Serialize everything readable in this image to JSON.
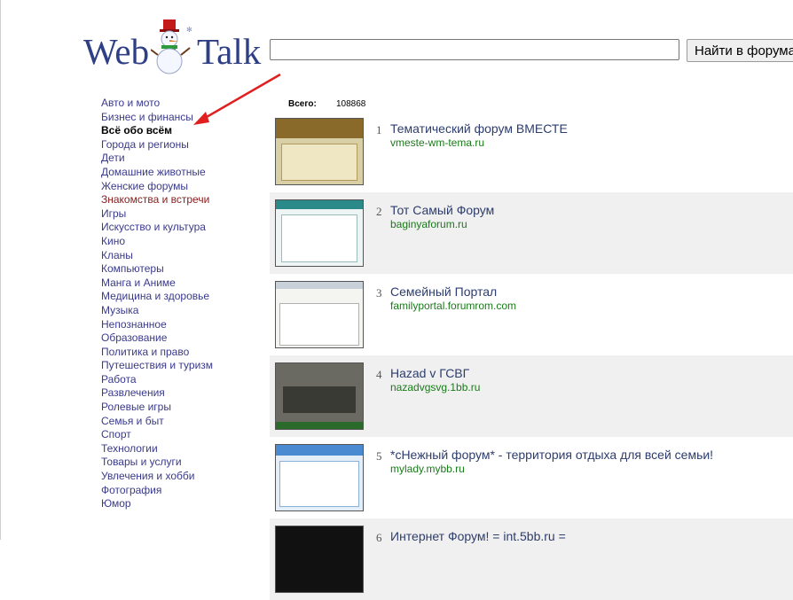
{
  "logo": {
    "word1": "Web",
    "word2": "Talk"
  },
  "search": {
    "value": "",
    "placeholder": "",
    "button_label": "Найти в форумах"
  },
  "categories": [
    "Авто и мото",
    "Бизнес и финансы",
    "Всё обо всём",
    "Города и регионы",
    "Дети",
    "Домашние животные",
    "Женские форумы",
    "Знакомства и встречи",
    "Игры",
    "Искусство и культура",
    "Кино",
    "Кланы",
    "Компьютеры",
    "Манга и Аниме",
    "Медицина и здоровье",
    "Музыка",
    "Непознанное",
    "Образование",
    "Политика и право",
    "Путешествия и туризм",
    "Работа",
    "Развлечения",
    "Ролевые игры",
    "Семья и быт",
    "Спорт",
    "Технологии",
    "Товары и услуги",
    "Увлечения и хобби",
    "Фотография",
    "Юмор"
  ],
  "total": {
    "label": "Всего:",
    "value": "108868"
  },
  "forums": [
    {
      "rank": "1",
      "title": "Тематический форум ВМЕСТЕ",
      "url": "vmeste-wm-tema.ru"
    },
    {
      "rank": "2",
      "title": "Тот Самый Форум",
      "url": "baginyaforum.ru"
    },
    {
      "rank": "3",
      "title": "Семейный Портал",
      "url": "familyportal.forumrom.com"
    },
    {
      "rank": "4",
      "title": "Hazad v ГСВГ",
      "url": "nazadvgsvg.1bb.ru"
    },
    {
      "rank": "5",
      "title": "*сНежный форум* - территория отдыха для всей семьи!",
      "url": "mylady.mybb.ru"
    },
    {
      "rank": "6",
      "title": "Интернет Форум! = int.5bb.ru =",
      "url": ""
    }
  ],
  "colors": {
    "link": "#3a3a8c",
    "url": "#1a7a1a",
    "active": "#000000",
    "highlight": "#8b1a1a",
    "arrow": "#e02020"
  }
}
